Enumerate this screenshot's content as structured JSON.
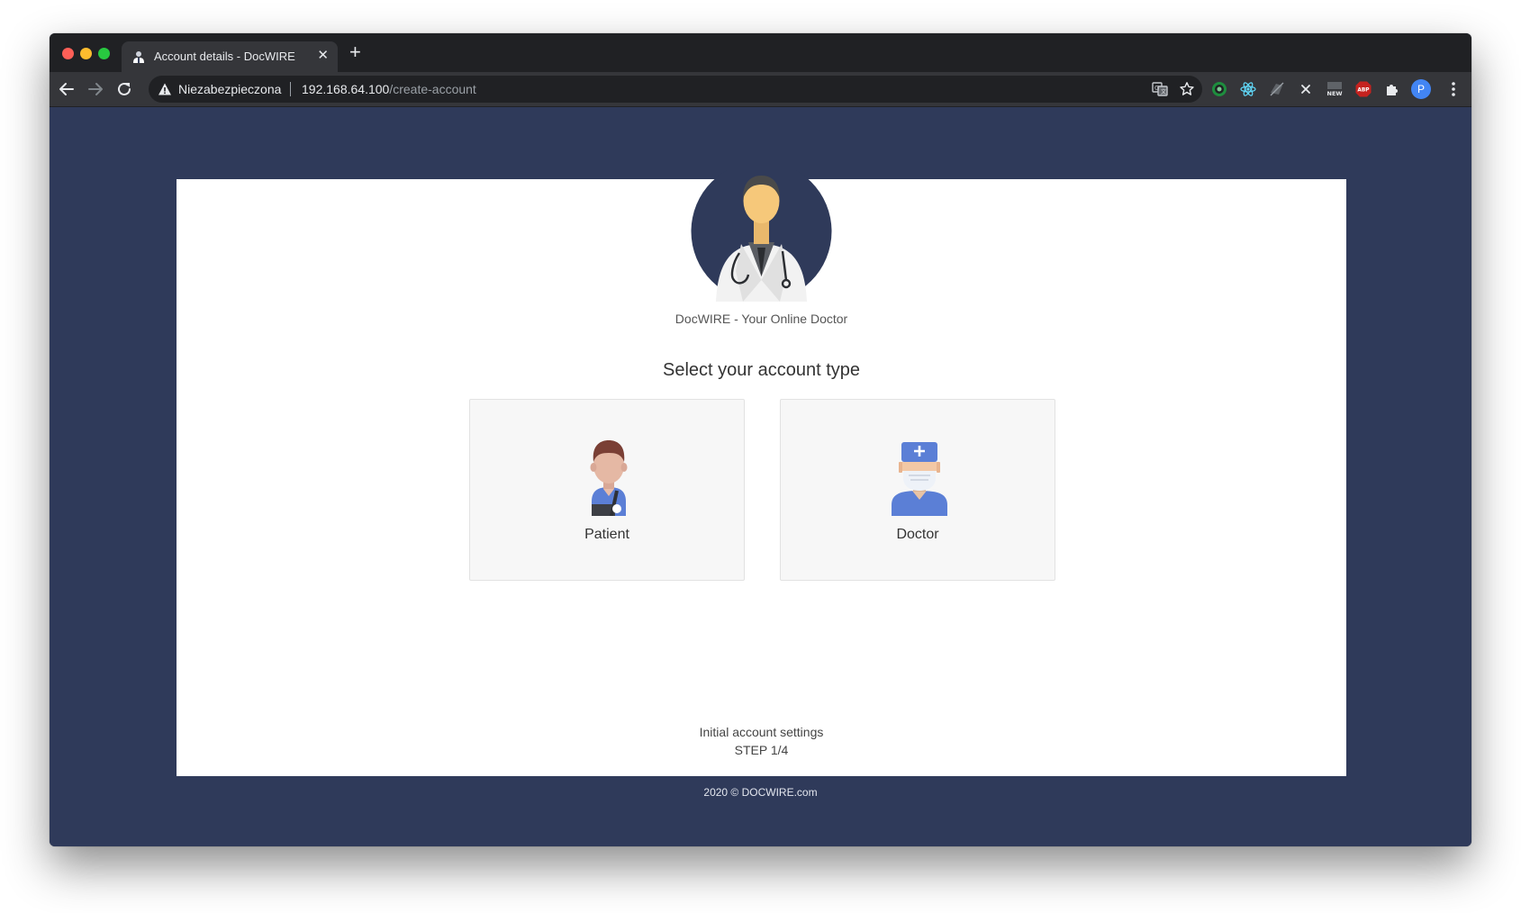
{
  "browser": {
    "tab_title": "Account details - DocWIRE",
    "tab_close_glyph": "✕",
    "new_tab_glyph": "+",
    "security_label": "Niezabezpieczona",
    "url_host": "192.168.64.100",
    "url_path": "/create-account",
    "profile_initial": "P",
    "icons": [
      "back-arrow-icon",
      "forward-arrow-icon",
      "reload-icon",
      "warning-icon",
      "translate-icon",
      "bookmark-star-icon",
      "extension-icon",
      "kebab-menu-icon"
    ],
    "extension_labels": {
      "new": "NEW",
      "abp": "ABP"
    }
  },
  "page": {
    "brand_text": "DocWIRE - Your Online Doctor",
    "select_title": "Select your account type",
    "account_types": [
      {
        "label": "Patient",
        "icon": "patient-icon"
      },
      {
        "label": "Doctor",
        "icon": "doctor-icon"
      }
    ],
    "step_title": "Initial account settings",
    "step_progress": "STEP 1/4",
    "footer": "2020 © DOCWIRE.com"
  },
  "colors": {
    "page_background": "#2f3a5a",
    "card_background": "#ffffff",
    "option_background": "#f7f7f7",
    "chrome_dark": "#202124",
    "chrome_toolbar": "#35363a"
  }
}
